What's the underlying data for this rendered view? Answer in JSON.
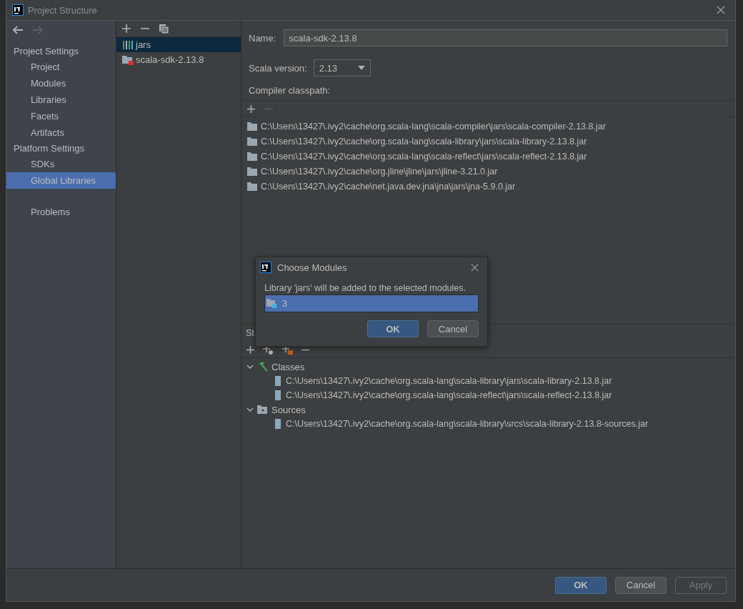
{
  "window": {
    "title": "Project Structure"
  },
  "nav": [
    {
      "kind": "back",
      "disabled": false
    },
    {
      "kind": "forward",
      "disabled": true
    }
  ],
  "sidebar": {
    "sections": [
      {
        "heading": "Project Settings",
        "items": [
          {
            "label": "Project",
            "selected": false
          },
          {
            "label": "Modules",
            "selected": false
          },
          {
            "label": "Libraries",
            "selected": false
          },
          {
            "label": "Facets",
            "selected": false
          },
          {
            "label": "Artifacts",
            "selected": false
          }
        ]
      },
      {
        "heading": "Platform Settings",
        "items": [
          {
            "label": "SDKs",
            "selected": false
          },
          {
            "label": "Global Libraries",
            "selected": true
          }
        ]
      },
      {
        "items": [
          {
            "label": "Problems",
            "selected": false
          }
        ]
      }
    ]
  },
  "library_list": {
    "items": [
      {
        "label": "jars",
        "kind": "jars",
        "selected": true
      },
      {
        "label": "scala-sdk-2.13.8",
        "kind": "sdk",
        "selected": false
      }
    ]
  },
  "details": {
    "name_label": "Name:",
    "name": "scala-sdk-2.13.8",
    "version_label": "Scala version:",
    "version": "2.13",
    "classpath_label": "Compiler classpath:",
    "classpath": [
      "C:\\Users\\13427\\.ivy2\\cache\\org.scala-lang\\scala-compiler\\jars\\scala-compiler-2.13.8.jar",
      "C:\\Users\\13427\\.ivy2\\cache\\org.scala-lang\\scala-library\\jars\\scala-library-2.13.8.jar",
      "C:\\Users\\13427\\.ivy2\\cache\\org.scala-lang\\scala-reflect\\jars\\scala-reflect-2.13.8.jar",
      "C:\\Users\\13427\\.ivy2\\cache\\org.jline\\jline\\jars\\jline-3.21.0.jar",
      "C:\\Users\\13427\\.ivy2\\cache\\net.java.dev.jna\\jna\\jars\\jna-5.9.0.jar"
    ],
    "roots_label": "St",
    "tree": [
      {
        "label": "Classes",
        "kind": "classes",
        "expanded": true,
        "children": [
          {
            "label": "C:\\Users\\13427\\.ivy2\\cache\\org.scala-lang\\scala-library\\jars\\scala-library-2.13.8.jar"
          },
          {
            "label": "C:\\Users\\13427\\.ivy2\\cache\\org.scala-lang\\scala-reflect\\jars\\scala-reflect-2.13.8.jar"
          }
        ]
      },
      {
        "label": "Sources",
        "kind": "sources",
        "expanded": true,
        "children": [
          {
            "label": "C:\\Users\\13427\\.ivy2\\cache\\org.scala-lang\\scala-library\\srcs\\scala-library-2.13.8-sources.jar"
          }
        ]
      }
    ]
  },
  "dialog": {
    "title": "Choose Modules",
    "message": "Library 'jars' will be added to the selected modules.",
    "modules": [
      {
        "label": "3",
        "selected": true
      }
    ],
    "buttons": [
      {
        "label": "OK",
        "default": true
      },
      {
        "label": "Cancel",
        "default": false
      }
    ]
  },
  "buttons": [
    {
      "label": "OK",
      "default": true,
      "disabled": false
    },
    {
      "label": "Cancel",
      "default": false,
      "disabled": false
    },
    {
      "label": "Apply",
      "default": false,
      "disabled": true
    }
  ]
}
